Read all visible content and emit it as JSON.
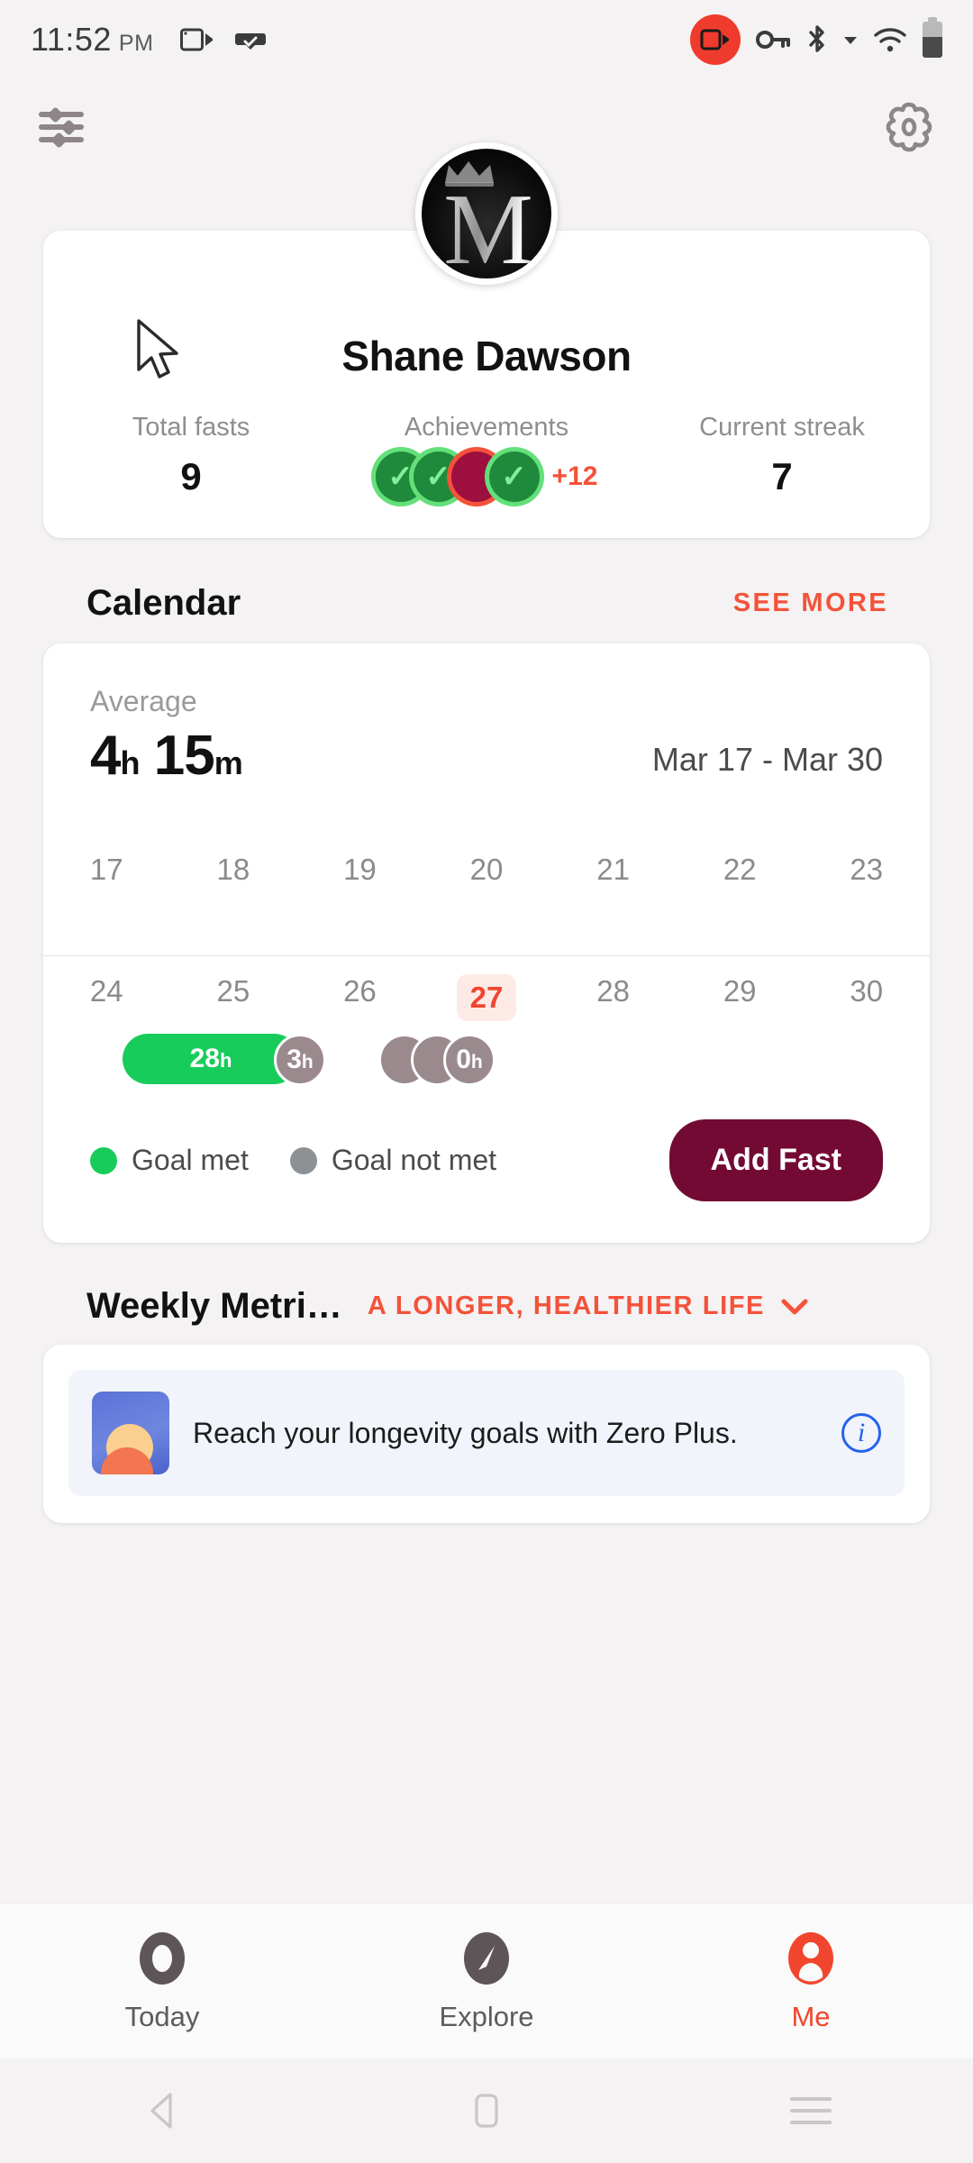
{
  "status_bar": {
    "time": "11:52",
    "ampm": "PM",
    "icons": [
      "cast-icon",
      "vr-check-icon",
      "screen-record-icon",
      "vpn-key-icon",
      "bluetooth-icon",
      "wifi-icon",
      "battery-icon"
    ]
  },
  "app_bar": {
    "filters_icon": "sliders-icon",
    "settings_icon": "gear-icon"
  },
  "profile": {
    "avatar_monogram": "M",
    "name": "Shane Dawson",
    "stats": [
      {
        "label": "Total fasts",
        "value": "9"
      },
      {
        "label": "Achievements",
        "value": "+12"
      },
      {
        "label": "Current streak",
        "value": "7"
      }
    ],
    "achievement_badges": [
      "green",
      "green",
      "red",
      "green"
    ],
    "achievement_more": "+12"
  },
  "calendar_section": {
    "title": "Calendar",
    "see_more": "SEE MORE",
    "average_label": "Average",
    "average_hours": "4",
    "average_hours_unit": "h",
    "average_minutes": "15",
    "average_minutes_unit": "m",
    "date_range": "Mar 17 - Mar 30",
    "week1": [
      "17",
      "18",
      "19",
      "20",
      "21",
      "22",
      "23"
    ],
    "week2": [
      "24",
      "25",
      "26",
      "27",
      "28",
      "29",
      "30"
    ],
    "today": "27",
    "entries": [
      {
        "label": "28",
        "unit": "h",
        "type": "goal-met"
      },
      {
        "label": "3",
        "unit": "h",
        "type": "goal-not-met"
      },
      {
        "label": "0",
        "unit": "h",
        "type": "goal-not-met"
      }
    ],
    "legend": [
      {
        "label": "Goal met",
        "color": "#18cc5c"
      },
      {
        "label": "Goal not met",
        "color": "#8c9196"
      }
    ],
    "add_fast_label": "Add Fast"
  },
  "weekly_metrics": {
    "title": "Weekly Metri…",
    "tag": "A LONGER, HEALTHIER LIFE",
    "chevron_icon": "chevron-down-icon"
  },
  "promo": {
    "text": "Reach your longevity goals with Zero Plus.",
    "info_icon": "info-icon",
    "thumb_icon": "longevity-thumbnail"
  },
  "bottom_nav": {
    "items": [
      {
        "label": "Today",
        "icon": "ring-icon",
        "active": false
      },
      {
        "label": "Explore",
        "icon": "compass-icon",
        "active": false
      },
      {
        "label": "Me",
        "icon": "person-icon",
        "active": true
      }
    ]
  },
  "android_nav": {
    "back": "back-triangle-icon",
    "home": "home-square-icon",
    "recents": "recents-menu-icon"
  },
  "colors": {
    "accent": "#f4523a",
    "goal_met": "#18cc5c",
    "goal_not_met": "#8c9196",
    "button": "#730a33",
    "today_highlight": "#f0462e"
  }
}
